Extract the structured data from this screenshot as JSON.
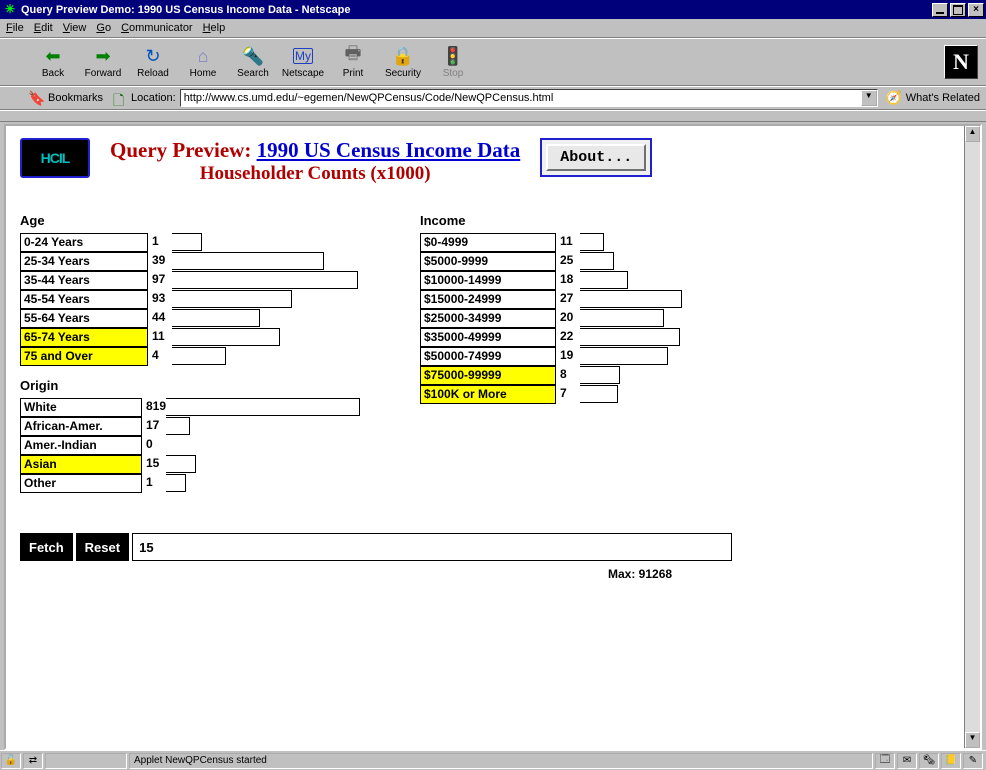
{
  "window": {
    "title": "Query Preview Demo: 1990 US Census Income Data - Netscape"
  },
  "menu": {
    "file": "File",
    "edit": "Edit",
    "view": "View",
    "go": "Go",
    "communicator": "Communicator",
    "help": "Help"
  },
  "toolbar": {
    "back": "Back",
    "forward": "Forward",
    "reload": "Reload",
    "home": "Home",
    "search": "Search",
    "netscape": "Netscape",
    "print": "Print",
    "security": "Security",
    "stop": "Stop",
    "logo": "N"
  },
  "location": {
    "bookmarks": "Bookmarks",
    "label": "Location:",
    "url": "http://www.cs.umd.edu/~egemen/NewQPCensus/Code/NewQPCensus.html",
    "related": "What's Related"
  },
  "page": {
    "hcil": "HCIL",
    "title_prefix": "Query Preview: ",
    "title_link": "1990 US Census Income Data",
    "subtitle": "Householder Counts (x1000)",
    "about": "About..."
  },
  "facets": {
    "age": {
      "title": "Age",
      "rows": [
        {
          "label": "0-24 Years",
          "count": "1",
          "bar": 30,
          "sel": false
        },
        {
          "label": "25-34 Years",
          "count": "39",
          "bar": 152,
          "sel": false
        },
        {
          "label": "35-44 Years",
          "count": "97",
          "bar": 186,
          "sel": false
        },
        {
          "label": "45-54 Years",
          "count": "93",
          "bar": 120,
          "sel": false
        },
        {
          "label": "55-64 Years",
          "count": "44",
          "bar": 88,
          "sel": false
        },
        {
          "label": "65-74 Years",
          "count": "11",
          "bar": 108,
          "sel": true
        },
        {
          "label": "75 and Over",
          "count": "4",
          "bar": 54,
          "sel": true
        }
      ]
    },
    "origin": {
      "title": "Origin",
      "rows": [
        {
          "label": "White",
          "count": "819",
          "bar": 194,
          "sel": false
        },
        {
          "label": "African-Amer.",
          "count": "17",
          "bar": 24,
          "sel": false
        },
        {
          "label": "Amer.-Indian",
          "count": "0",
          "bar": 0,
          "sel": false
        },
        {
          "label": "Asian",
          "count": "15",
          "bar": 30,
          "sel": true
        },
        {
          "label": "Other",
          "count": "1",
          "bar": 20,
          "sel": false
        }
      ]
    },
    "income": {
      "title": "Income",
      "rows": [
        {
          "label": "$0-4999",
          "count": "11",
          "bar": 24,
          "sel": false
        },
        {
          "label": "$5000-9999",
          "count": "25",
          "bar": 34,
          "sel": false
        },
        {
          "label": "$10000-14999",
          "count": "18",
          "bar": 48,
          "sel": false
        },
        {
          "label": "$15000-24999",
          "count": "27",
          "bar": 102,
          "sel": false
        },
        {
          "label": "$25000-34999",
          "count": "20",
          "bar": 84,
          "sel": false
        },
        {
          "label": "$35000-49999",
          "count": "22",
          "bar": 100,
          "sel": false
        },
        {
          "label": "$50000-74999",
          "count": "19",
          "bar": 88,
          "sel": false
        },
        {
          "label": "$75000-99999",
          "count": "8",
          "bar": 40,
          "sel": true
        },
        {
          "label": "$100K or More",
          "count": "7",
          "bar": 38,
          "sel": true
        }
      ]
    }
  },
  "actions": {
    "fetch": "Fetch",
    "reset": "Reset",
    "result_count": "15",
    "max": "Max: 91268"
  },
  "status": {
    "text": "Applet NewQPCensus started"
  },
  "chart_data": [
    {
      "type": "bar",
      "title": "Age",
      "categories": [
        "0-24 Years",
        "25-34 Years",
        "35-44 Years",
        "45-54 Years",
        "55-64 Years",
        "65-74 Years",
        "75 and Over"
      ],
      "values": [
        1,
        39,
        97,
        93,
        44,
        11,
        4
      ],
      "selected": [
        "65-74 Years",
        "75 and Over"
      ]
    },
    {
      "type": "bar",
      "title": "Origin",
      "categories": [
        "White",
        "African-Amer.",
        "Amer.-Indian",
        "Asian",
        "Other"
      ],
      "values": [
        819,
        17,
        0,
        15,
        1
      ],
      "selected": [
        "Asian"
      ]
    },
    {
      "type": "bar",
      "title": "Income",
      "categories": [
        "$0-4999",
        "$5000-9999",
        "$10000-14999",
        "$15000-24999",
        "$25000-34999",
        "$35000-49999",
        "$50000-74999",
        "$75000-99999",
        "$100K or More"
      ],
      "values": [
        11,
        25,
        18,
        27,
        20,
        22,
        19,
        8,
        7
      ],
      "selected": [
        "$75000-99999",
        "$100K or More"
      ]
    }
  ]
}
